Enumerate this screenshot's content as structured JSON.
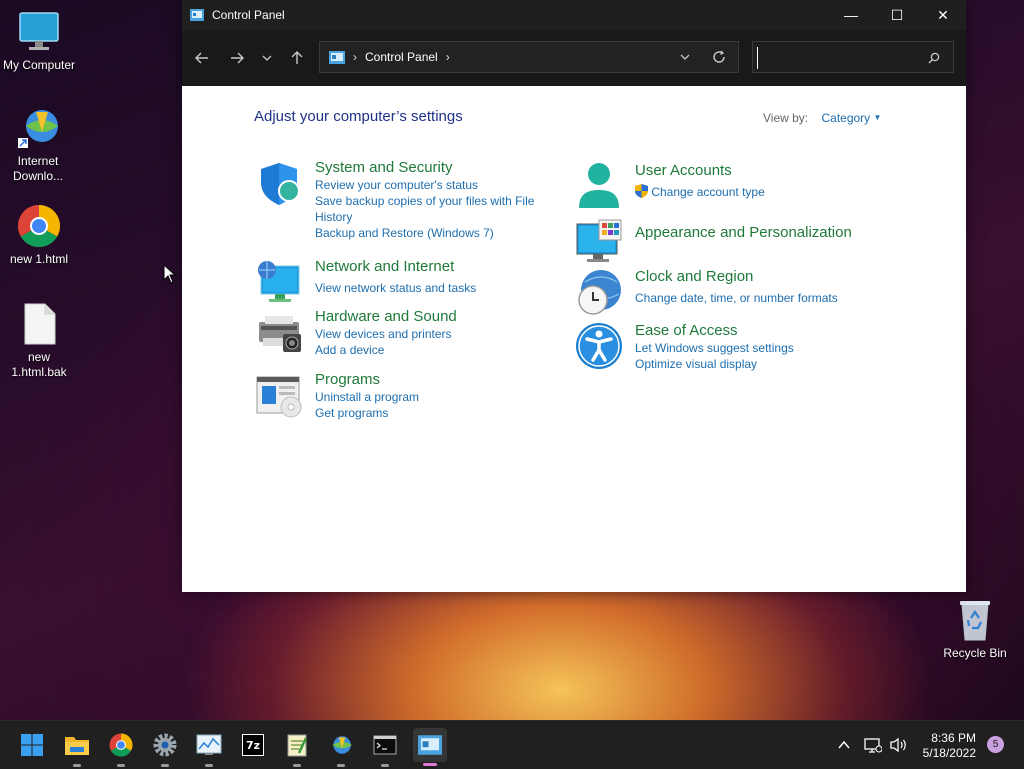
{
  "desktop": {
    "icons": [
      {
        "label": "My Computer"
      },
      {
        "label": "Internet Downlo..."
      },
      {
        "label": "new 1.html"
      },
      {
        "label": "new 1.html.bak"
      },
      {
        "label": "Recycle Bin"
      }
    ]
  },
  "window": {
    "title": "Control Panel",
    "controls": {
      "minimize": "—",
      "maximize": "☐",
      "close": "✕"
    }
  },
  "address_bar": {
    "breadcrumb": "Control Panel",
    "separator": "›"
  },
  "search": {
    "placeholder": ""
  },
  "content": {
    "heading": "Adjust your computer’s settings",
    "view_by_label": "View by:",
    "view_by_value": "Category",
    "left_items": [
      {
        "title": "System and Security",
        "links": [
          "Review your computer's status",
          "Save backup copies of your files with File History",
          "Backup and Restore (Windows 7)"
        ]
      },
      {
        "title": "Network and Internet",
        "links": [
          "View network status and tasks"
        ]
      },
      {
        "title": "Hardware and Sound",
        "links": [
          "View devices and printers",
          "Add a device"
        ]
      },
      {
        "title": "Programs",
        "links": [
          "Uninstall a program",
          "Get programs"
        ]
      }
    ],
    "right_items": [
      {
        "title": "User Accounts",
        "links": [
          "Change account type"
        ]
      },
      {
        "title": "Appearance and Personalization",
        "links": []
      },
      {
        "title": "Clock and Region",
        "links": [
          "Change date, time, or number formats"
        ]
      },
      {
        "title": "Ease of Access",
        "links": [
          "Let Windows suggest settings",
          "Optimize visual display"
        ]
      }
    ]
  },
  "taskbar": {
    "apps": [
      "start-icon",
      "file-explorer-icon",
      "chrome-icon",
      "settings-icon",
      "resource-monitor-icon",
      "7zip-icon",
      "notepad-icon",
      "internet-download-manager-icon",
      "terminal-icon",
      "control-panel-icon"
    ],
    "tray": {
      "time": "8:36 PM",
      "date": "5/18/2022",
      "notification_count": "5"
    }
  },
  "colors": {
    "title_bar": "#1f1f1f",
    "category_title": "#1f7a3a",
    "link": "#1e6fb0",
    "heading": "#1e3287"
  }
}
